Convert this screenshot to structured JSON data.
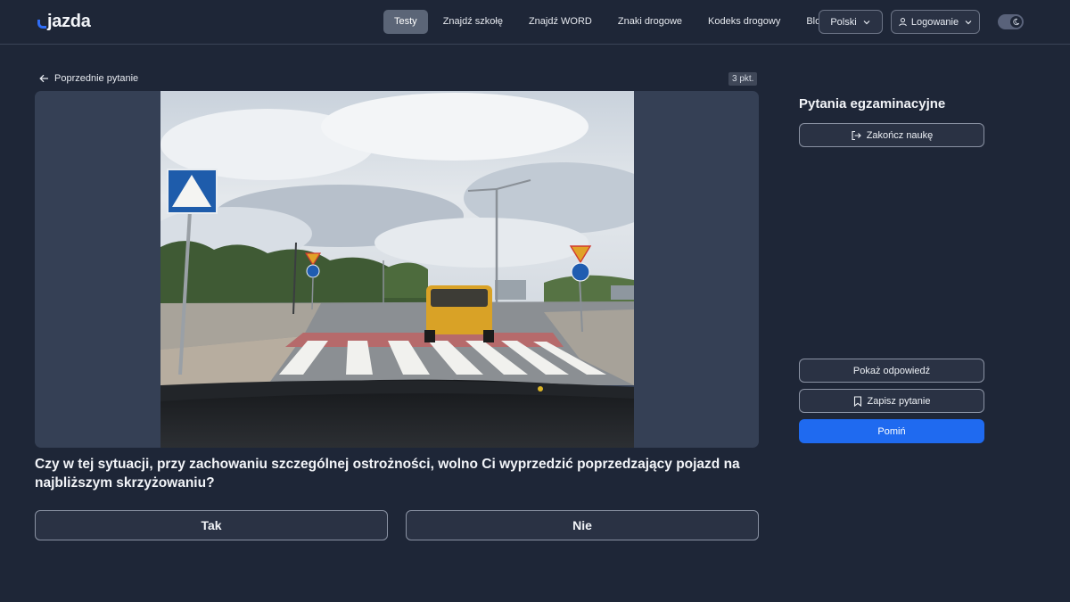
{
  "header": {
    "logo_text": "jazda",
    "nav": [
      {
        "label": "Testy",
        "active": true
      },
      {
        "label": "Znajdź szkołę",
        "active": false
      },
      {
        "label": "Znajdź WORD",
        "active": false
      },
      {
        "label": "Znaki drogowe",
        "active": false
      },
      {
        "label": "Kodeks drogowy",
        "active": false
      },
      {
        "label": "Blog",
        "active": false
      }
    ],
    "language": "Polski",
    "login": "Logowanie",
    "theme_toggle_icon": "moon-icon"
  },
  "main": {
    "back_link": "Poprzednie pytanie",
    "points": "3 pkt.",
    "question": "Czy w tej sytuacji, przy zachowaniu szczególnej ostrożności, wolno Ci wyprzedzić poprzedzający pojazd na najbliższym skrzyżowaniu?",
    "answers": [
      "Tak",
      "Nie"
    ]
  },
  "sidebar": {
    "title": "Pytania egzaminacyjne",
    "finish": "Zakończ naukę",
    "show_answer": "Pokaż odpowiedź",
    "save_question": "Zapisz pytanie",
    "skip": "Pomiń"
  },
  "colors": {
    "background": "#1e2637",
    "accent": "#1f6af0",
    "panel": "#354055"
  }
}
